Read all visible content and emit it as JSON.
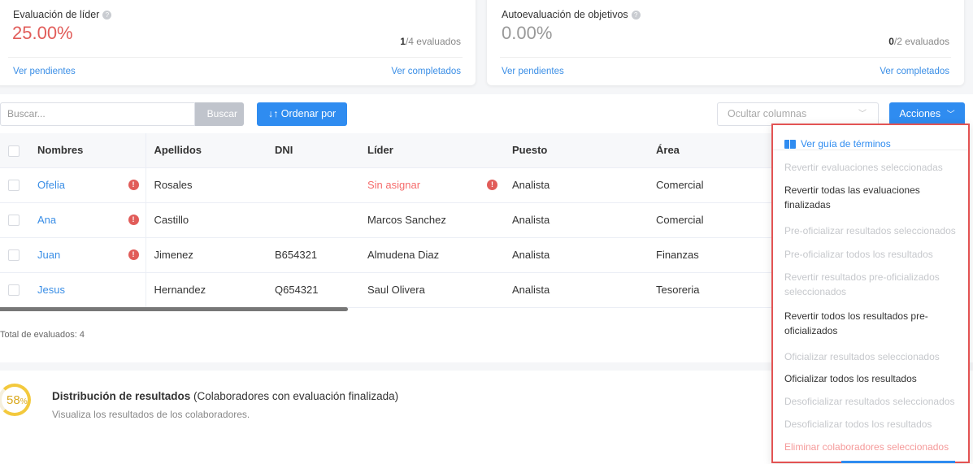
{
  "stats": {
    "leader": {
      "title": "Evaluación de líder",
      "percent": "25.00%",
      "count": "1",
      "count_rest": "/4 evaluados",
      "pending": "Ver pendientes",
      "completed": "Ver completados",
      "percent_color": "#e15c59"
    },
    "self": {
      "title": "Autoevaluación de objetivos",
      "percent": "0.00%",
      "count": "0",
      "count_rest": "/2 evaluados",
      "pending": "Ver pendientes",
      "completed": "Ver completados",
      "percent_color": "#999999"
    }
  },
  "toolbar": {
    "search_placeholder": "Buscar...",
    "search_button": "Buscar",
    "order_button": "↓↑ Ordenar por",
    "hide_columns": "Ocultar columnas",
    "actions_button": "Acciones"
  },
  "table": {
    "headers": [
      "Nombres",
      "Apellidos",
      "DNI",
      "Líder",
      "Puesto",
      "Área"
    ],
    "rows": [
      {
        "nombre": "Ofelia",
        "apellido": "Rosales",
        "dni": "",
        "lider": "Sin asignar",
        "puesto": "Analista",
        "area": "Comercial"
      },
      {
        "nombre": "Ana",
        "apellido": "Castillo",
        "dni": "",
        "lider": "Marcos Sanchez",
        "puesto": "Analista",
        "area": "Comercial"
      },
      {
        "nombre": "Juan",
        "apellido": "Jimenez",
        "dni": "B654321",
        "lider": "Almudena Diaz",
        "puesto": "Analista",
        "area": "Finanzas"
      },
      {
        "nombre": "Jesus",
        "apellido": "Hernandez",
        "dni": "Q654321",
        "lider": "Saul Olivera",
        "puesto": "Analista",
        "area": "Tesoreria"
      }
    ],
    "total": "Total de evaluados: 4"
  },
  "distribution": {
    "percent": "58",
    "percent_suffix": "%",
    "title_bold": "Distribución de resultados",
    "title_rest": " (Colaboradores con evaluación finalizada)",
    "subtitle": "Visualiza los resultados de los colaboradores."
  },
  "dropdown": {
    "guide": "Ver guía de términos",
    "items": [
      {
        "label": "Revertir evaluaciones seleccionadas",
        "state": "disabled"
      },
      {
        "label": "Revertir todas las evaluaciones finalizadas",
        "state": "enabled"
      },
      {
        "label": "Pre-oficializar resultados seleccionados",
        "state": "disabled"
      },
      {
        "label": "Pre-oficializar todos los resultados",
        "state": "disabled"
      },
      {
        "label": "Revertir resultados pre-oficializados seleccionados",
        "state": "disabled"
      },
      {
        "label": "Revertir todos los resultados pre-oficializados",
        "state": "enabled"
      },
      {
        "label": "Oficializar resultados seleccionados",
        "state": "disabled"
      },
      {
        "label": "Oficializar todos los resultados",
        "state": "enabled"
      },
      {
        "label": "Desoficializar resultados seleccionados",
        "state": "disabled"
      },
      {
        "label": "Desoficializar todos los resultados",
        "state": "disabled"
      },
      {
        "label": "Eliminar colaboradores seleccionados",
        "state": "danger"
      }
    ]
  }
}
